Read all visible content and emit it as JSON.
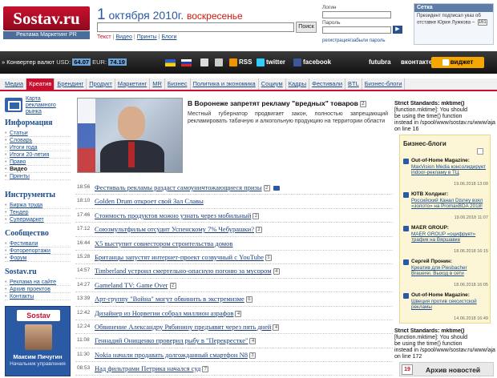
{
  "header": {
    "logo": "Sostav.ru",
    "logo_sub": "Реклама Маркетинг PR",
    "date_day": "1",
    "date_rest": "октября 2010г.",
    "weekday": "воскресенье",
    "search_button": "Поиск",
    "links": [
      "Текст",
      "Видео",
      "Принты",
      "Блоги"
    ],
    "login_label": "Логин",
    "password_label": "Пароль",
    "reg_links": "регистрация/забыли пароль",
    "setka_title": "Сетка",
    "setka_text": "Президент подписал указ об отставке Юрия Лужкова –",
    "setka_badge": "161"
  },
  "darkbar": {
    "converter_label": "Конвертер валют",
    "usd_label": "USD:",
    "usd_value": "64.07",
    "eur_label": "EUR:",
    "eur_value": "74.19",
    "rss": "RSS",
    "twitter": "twitter",
    "facebook": "facebook",
    "futubra": "futubra",
    "vkontakte": "вконтакте",
    "widget": "виджет"
  },
  "nav": [
    "Медиа",
    "Креатив",
    "Брендинг",
    "Продукт",
    "Маркетинг",
    "MR",
    "Бизнес",
    "Политика и экономика",
    "Социум",
    "Кадры",
    "Фестивали",
    "BTL",
    "Бизнес-блоги"
  ],
  "sidebar": {
    "map_text": "Карта рекламного рынка",
    "sections": [
      {
        "title": "Информация",
        "items": [
          "Статьи",
          "Словарь",
          "Итоги года",
          "Итоги 20-летия",
          "Право",
          "Видео",
          "Принты"
        ]
      },
      {
        "title": "Инструменты",
        "items": [
          "Биржа труда",
          "Тендер",
          "Супермаркет"
        ]
      },
      {
        "title": "Сообщество",
        "items": [
          "Фестивали",
          "Фоторепортажи",
          "Форум"
        ]
      },
      {
        "title": "Sostav.ru",
        "items": [
          "Реклама на сайте",
          "Архив проектов",
          "Контакты"
        ]
      }
    ],
    "promo_logo": "Sostav",
    "promo_name": "Максим Пичугин",
    "promo_role": "Начальник управления"
  },
  "feature": {
    "title": "В Воронеже запретят рекламу \"вредных\" товаров",
    "badge": "2",
    "text": "Местный губернатор продвигает закон, полностью запрещающий рекламировать табачную и алкогольную продукцию на территории области"
  },
  "news": [
    {
      "time": "18:56",
      "title": "Фестиваль рекламы раздаст самоуничтожающиеся призы",
      "badge": "2",
      "video": true
    },
    {
      "time": "18:10",
      "title": "Golden Drum откроет свой Зал Славы",
      "badge": "",
      "video": false
    },
    {
      "time": "17:46",
      "title": "Стоимость продуктов можно узнать через мобильный",
      "badge": "2",
      "video": false
    },
    {
      "time": "17:12",
      "title": "Союзмультфильм отсудит Успенскому 7% Чебурашки?",
      "badge": "2",
      "video": false
    },
    {
      "time": "16:44",
      "title": "X5 выступит совиестором строительства домов",
      "badge": "",
      "video": false
    },
    {
      "time": "15:28",
      "title": "Британцы запустят интернет-проект созвучный с YouTube",
      "badge": "1",
      "video": false
    },
    {
      "time": "14:57",
      "title": "Timberland устроил смертельно-опасную погоню за мусором",
      "badge": "4",
      "video": false
    },
    {
      "time": "14:27",
      "title": "Gameland TV: Game Over",
      "badge": "2",
      "video": false
    },
    {
      "time": "13:39",
      "title": "Арт-группу \"Война\" могут обвинить в экстремизме",
      "badge": "6",
      "video": false
    },
    {
      "time": "12:42",
      "title": "Дизайнер из Норвегии собрал миллион азрафов",
      "badge": "4",
      "video": false
    },
    {
      "time": "12:24",
      "title": "Обвинение Александру Рябинину предъявят через пять дней",
      "badge": "4",
      "video": false
    },
    {
      "time": "11:08",
      "title": "Геннадий Онищенко проверил рыбу в \"Перекрестке\"",
      "badge": "4",
      "video": false
    },
    {
      "time": "11:30",
      "title": "Nokia начали продавать долгожданный смартфон N8",
      "badge": "3",
      "video": false
    },
    {
      "time": "08:53",
      "title": "Над фильтрами Петрика начался суд",
      "badge": "7",
      "video": false
    }
  ],
  "right": {
    "strict1": [
      "Strict Standards: mktime()",
      "[function.mktime]: You should",
      "be using the time() function",
      "instead in /spool/www/sostav.ru/www/ajax",
      "on line 16"
    ],
    "blogs_title": "Бизнес-блоги",
    "blogs": [
      {
        "author": "Out-of-Home Magazine:",
        "title": "MaxVision Media консолидирует indoor-рекламу в ТЦ",
        "date": "19.06.2018 13:09"
      },
      {
        "author": "ЮТВ Холдинг:",
        "title": "Российский Канал Disney взял «золото» на PromaxBDA 2018!",
        "date": "19.06.2018 11:07"
      },
      {
        "author": "MAER GROUP:",
        "title": "MAER GROUP «оцифрует» трафик на Вяршавке",
        "date": "18.06.2018 16:15"
      },
      {
        "author": "Сергей Пронин:",
        "title": "Креатив для Plesbacher Brauerei. Выход в сети",
        "date": "18.06.2018 16:05"
      },
      {
        "author": "Out-of-Home Magazine:",
        "title": "Швеция против сексистской рекламы",
        "date": "14.06.2018 16:49"
      }
    ],
    "strict2": [
      "Strict Standards: mktime()",
      "[function.mktime]: You should",
      "be using the time() function",
      "instead in /spool/www/sostav.ru/www/ajax",
      "on line 172"
    ],
    "archive_day": "19",
    "archive_label": "Архив новостей"
  }
}
